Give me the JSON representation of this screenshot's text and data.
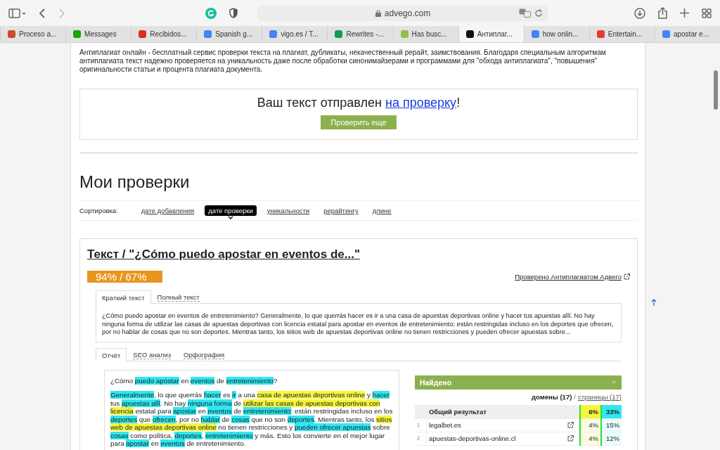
{
  "browser": {
    "url": "advego.com",
    "tabs": [
      {
        "label": "Proceso a...",
        "selected": false,
        "color": "#d0472f"
      },
      {
        "label": "Messages",
        "selected": false,
        "color": "#14a800"
      },
      {
        "label": "Recibidos...",
        "selected": false,
        "color": "#d93025"
      },
      {
        "label": "Spanish g...",
        "selected": false,
        "color": "#4285f4"
      },
      {
        "label": "vigo.es / T...",
        "selected": false,
        "color": "#4285f4"
      },
      {
        "label": "Rewrites -...",
        "selected": false,
        "color": "#0f9d58"
      },
      {
        "label": "Has busc...",
        "selected": false,
        "color": "#8bc34a"
      },
      {
        "label": "Антиплаг...",
        "selected": true,
        "color": "#111111"
      },
      {
        "label": "how onlin...",
        "selected": false,
        "color": "#4285f4"
      },
      {
        "label": "Entertain...",
        "selected": false,
        "color": "#e53935"
      },
      {
        "label": "apostar e...",
        "selected": false,
        "color": "#4285f4"
      }
    ]
  },
  "intro": "Антиплагиат онлайн - бесплатный сервис проверки текста на плагиат, дубликаты, некачественный рерайт, заимствования. Благодаря специальным алгоритмам антиплагиата текст надежно проверяется на уникальность даже после обработки синонимайзерами и программами для \"обхода антиплагиата\", \"повышения\" оригинальности статьи и процента плагиата документа.",
  "notice": {
    "text": "Ваш текст отправлен ",
    "link": "на проверку",
    "end": "!",
    "button": "Проверить еще"
  },
  "heading": "Мои проверки",
  "sort": {
    "label": "Сортировка:",
    "options": [
      {
        "label": "дате добавления",
        "selected": false
      },
      {
        "label": "дате проверки",
        "selected": true
      },
      {
        "label": "уникальности",
        "selected": false
      },
      {
        "label": "рерайтингу",
        "selected": false
      },
      {
        "label": "длине",
        "selected": false
      }
    ]
  },
  "check": {
    "title": "Текст / \"¿Cómo puedo apostar en eventos de...\"",
    "score": "94% / 67%",
    "verified": "Проверено Антиплагиатом Адвего",
    "text_tabs": [
      {
        "label": "Краткий текст",
        "selected": true
      },
      {
        "label": "Полный текст",
        "selected": false
      }
    ],
    "excerpt": "¿Cómo puedo apostar en eventos de entretenimiento? Generalmente, lo que querrás hacer es ir a una casa de apuestas deportivas online y hacer tus apuestas allí. No hay ninguna forma de utilizar las casas de apuestas deportivas con licencia estatal para apostar en eventos de entretenimiento: están restringidas incluso en los deportes que ofrecen, por no hablar de cosas que no son deportes. Mientras tanto, los sitios web de apuestas deportivas online no tienen restricciones y pueden ofrecer apuestas sobre...",
    "report_tabs": [
      {
        "label": "Отчёт",
        "selected": true
      },
      {
        "label": "SEO анализ",
        "selected": false
      },
      {
        "label": "Орфография",
        "selected": false
      }
    ],
    "report": [
      [
        {
          "text": "¿Cómo ",
          "kind": "plain"
        },
        {
          "text": "puedo apostar",
          "kind": "word"
        },
        {
          "text": " en ",
          "kind": "plain"
        },
        {
          "text": "eventos",
          "kind": "word"
        },
        {
          "text": " de ",
          "kind": "plain"
        },
        {
          "text": "entretenimiento",
          "kind": "word"
        },
        {
          "text": "?",
          "kind": "plain"
        }
      ],
      [
        {
          "text": "Generalmente",
          "kind": "word"
        },
        {
          "text": ", lo que querrás ",
          "kind": "plain"
        },
        {
          "text": "hacer",
          "kind": "word"
        },
        {
          "text": " es ",
          "kind": "plain"
        },
        {
          "text": "ir",
          "kind": "word"
        },
        {
          "text": " a una ",
          "kind": "plain"
        },
        {
          "text": "casa de apuestas deportivas online",
          "kind": "phrase"
        },
        {
          "text": " y ",
          "kind": "plain"
        },
        {
          "text": "hacer",
          "kind": "word"
        },
        {
          "text": " tus ",
          "kind": "plain"
        },
        {
          "text": "apuestas allí",
          "kind": "word"
        },
        {
          "text": ". No hay ",
          "kind": "plain"
        },
        {
          "text": "ninguna forma",
          "kind": "word"
        },
        {
          "text": " de ",
          "kind": "plain"
        },
        {
          "text": "utilizar las casas de apuestas deportivas con licencia",
          "kind": "phrase"
        },
        {
          "text": " estatal para ",
          "kind": "plain"
        },
        {
          "text": "apostar",
          "kind": "word"
        },
        {
          "text": " en ",
          "kind": "plain"
        },
        {
          "text": "eventos",
          "kind": "word"
        },
        {
          "text": " de ",
          "kind": "plain"
        },
        {
          "text": "entretenimiento",
          "kind": "word"
        },
        {
          "text": ": están restringidas incluso en los ",
          "kind": "plain"
        },
        {
          "text": "deportes",
          "kind": "word"
        },
        {
          "text": " que ",
          "kind": "plain"
        },
        {
          "text": "ofrecen",
          "kind": "word"
        },
        {
          "text": ", por no ",
          "kind": "plain"
        },
        {
          "text": "hablar",
          "kind": "word"
        },
        {
          "text": " de ",
          "kind": "plain"
        },
        {
          "text": "cosas",
          "kind": "word"
        },
        {
          "text": " que no son ",
          "kind": "plain"
        },
        {
          "text": "deportes",
          "kind": "word"
        },
        {
          "text": ". Mientras tanto, los ",
          "kind": "plain"
        },
        {
          "text": "sitios web de apuestas deportivas online",
          "kind": "phrase"
        },
        {
          "text": " no tienen restricciones y ",
          "kind": "plain"
        },
        {
          "text": "pueden ofrecer apuestas",
          "kind": "word"
        },
        {
          "text": " sobre ",
          "kind": "plain"
        },
        {
          "text": "cosas",
          "kind": "word"
        },
        {
          "text": " como política, ",
          "kind": "plain"
        },
        {
          "text": "deportes",
          "kind": "word"
        },
        {
          "text": ", ",
          "kind": "plain"
        },
        {
          "text": "entretenimiento",
          "kind": "word"
        },
        {
          "text": " y más. Esto los convierte en el mejor lugar para ",
          "kind": "plain"
        },
        {
          "text": "apostar",
          "kind": "word"
        },
        {
          "text": " en ",
          "kind": "plain"
        },
        {
          "text": "eventos",
          "kind": "word"
        },
        {
          "text": " de entretenimiento.",
          "kind": "plain"
        }
      ]
    ],
    "found": {
      "title": "Найдено",
      "domains": "домены (17)",
      "separator": "/",
      "pages": "страницы (17)",
      "total": {
        "label": "Общий результат",
        "share_a": "6%",
        "share_b": "33%"
      },
      "rows": [
        {
          "number": "1",
          "domain": "legalbet.es",
          "share_a": "4%",
          "share_b": "15%"
        },
        {
          "number": "2",
          "domain": "apuestas-deportivas-online.cl",
          "share_a": "4%",
          "share_b": "12%"
        }
      ]
    }
  }
}
